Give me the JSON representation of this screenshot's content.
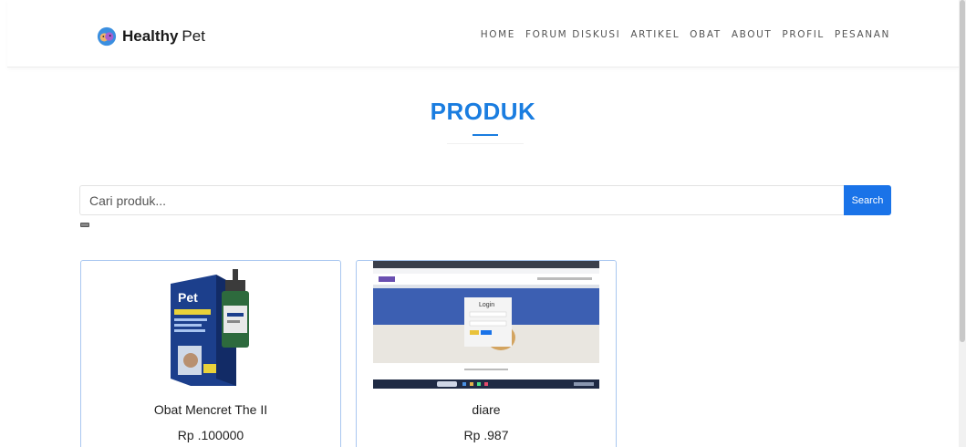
{
  "brand": {
    "name_bold": "Healthy",
    "name_light": "Pet"
  },
  "nav": {
    "items": [
      "HOME",
      "FORUM DISKUSI",
      "ARTIKEL",
      "OBAT",
      "ABOUT",
      "PROFIL",
      "PESANAN"
    ]
  },
  "section": {
    "title": "PRODUK"
  },
  "search": {
    "placeholder": "Cari produk...",
    "button_label": "Search"
  },
  "products": [
    {
      "name": "Obat Mencret The II",
      "price": "Rp .100000",
      "image_label": "Pet"
    },
    {
      "name": "diare",
      "price": "Rp .987",
      "image_title": "Login"
    }
  ],
  "colors": {
    "accent": "#1a7de0",
    "button": "#1a73e8",
    "card_border": "#a9c7f0"
  }
}
